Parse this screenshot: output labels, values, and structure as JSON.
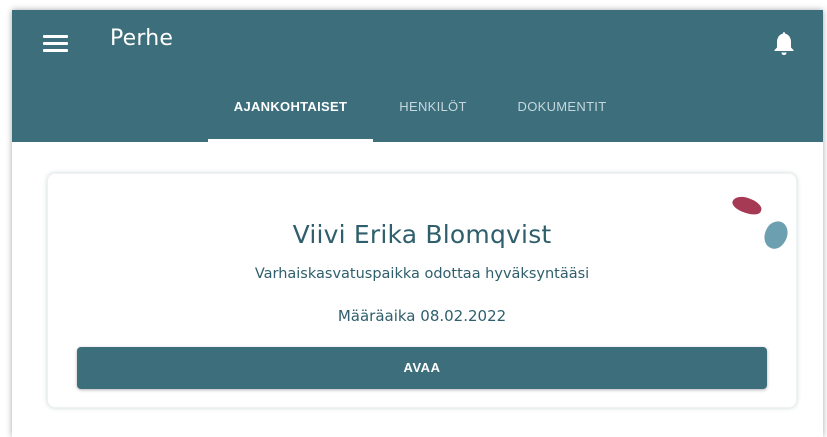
{
  "app": {
    "title": "Perhe",
    "menu_icon": "hamburger-menu-icon",
    "notification_icon": "bell-icon"
  },
  "tabs": [
    {
      "label": "AJANKOHTAISET",
      "active": true
    },
    {
      "label": "HENKILÖT",
      "active": false
    },
    {
      "label": "DOKUMENTIT",
      "active": false
    }
  ],
  "card": {
    "name": "Viivi Erika Blomqvist",
    "status": "Varhaiskasvatuspaikka odottaa hyväksyntääsi",
    "deadline": "Määräaika 08.02.2022",
    "button_label": "AVAA"
  },
  "colors": {
    "primary": "#3d6e7c",
    "text_primary": "#2f5f6c",
    "accent_red": "#a63a55",
    "accent_blue": "#6c9fb0"
  }
}
